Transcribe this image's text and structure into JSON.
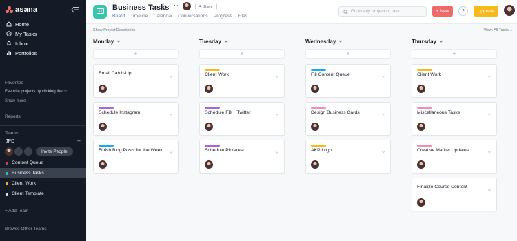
{
  "app": {
    "name": "asana"
  },
  "sidebar": {
    "nav": [
      {
        "label": "Home",
        "icon": "home-icon"
      },
      {
        "label": "My Tasks",
        "icon": "checkbox-icon"
      },
      {
        "label": "Inbox",
        "icon": "bell-icon"
      },
      {
        "label": "Portfolios",
        "icon": "bar-chart-icon"
      }
    ],
    "favorites_heading": "Favorites",
    "favorites_hint": "Favorite projects by clicking the ☆",
    "show_more": "Show more",
    "reports": "Reports",
    "teams_heading": "Teams",
    "team_name": "JPD",
    "invite_label": "Invite People",
    "projects": [
      {
        "label": "Content Queue",
        "color": "#e8384f"
      },
      {
        "label": "Business Tasks",
        "color": "#37c5ab"
      },
      {
        "label": "Client Work",
        "color": "#f8b91c"
      },
      {
        "label": "Client Template",
        "color": "#e5e5e5"
      }
    ],
    "add_team": "+ Add Team",
    "browse_teams": "Browse Other Teams"
  },
  "header": {
    "project_title": "Business Tasks",
    "share_label": "Share",
    "tabs": [
      "Board",
      "Timeline",
      "Calendar",
      "Conversations",
      "Progress",
      "Files"
    ],
    "active_tab": "Board",
    "search_placeholder": "Go to any project or task...",
    "new_label": "New",
    "help_label": "?",
    "upgrade_label": "Upgrade"
  },
  "subbar": {
    "description_link": "Show Project Description",
    "view_label": "View: All Tasks"
  },
  "colors": {
    "orange": "#f8b91c",
    "blue": "#14aaf5",
    "purple": "#a962e0",
    "pink": "#f38fb0"
  },
  "columns": [
    {
      "name": "Monday",
      "cards": [
        {
          "title": "Email Catch-Up",
          "tag": null
        },
        {
          "title": "Schedule Instagram",
          "tag": "#a962e0"
        },
        {
          "title": "Finish Blog Posts for the Week",
          "tag": "#14aaf5"
        }
      ]
    },
    {
      "name": "Tuesday",
      "cards": [
        {
          "title": "Client Work",
          "tag": "#f8b91c"
        },
        {
          "title": "Schedule FB + Twitter",
          "tag": "#a962e0"
        },
        {
          "title": "Schedule Pinterest",
          "tag": "#a962e0"
        }
      ]
    },
    {
      "name": "Wednesday",
      "cards": [
        {
          "title": "Fill Content Queue",
          "tag": "#14aaf5"
        },
        {
          "title": "Design Business Cards",
          "tag": "#f38fb0"
        },
        {
          "title": "AKP Logo",
          "tag": "#f8b91c"
        }
      ]
    },
    {
      "name": "Thursday",
      "cards": [
        {
          "title": "Client Work",
          "tag": "#f8b91c"
        },
        {
          "title": "Miscellaneous Tasks",
          "tag": "#f38fb0"
        },
        {
          "title": "Creative Market Updates",
          "tag": "#f38fb0"
        },
        {
          "title": "Finalize Course Content",
          "tag": null
        }
      ]
    }
  ]
}
